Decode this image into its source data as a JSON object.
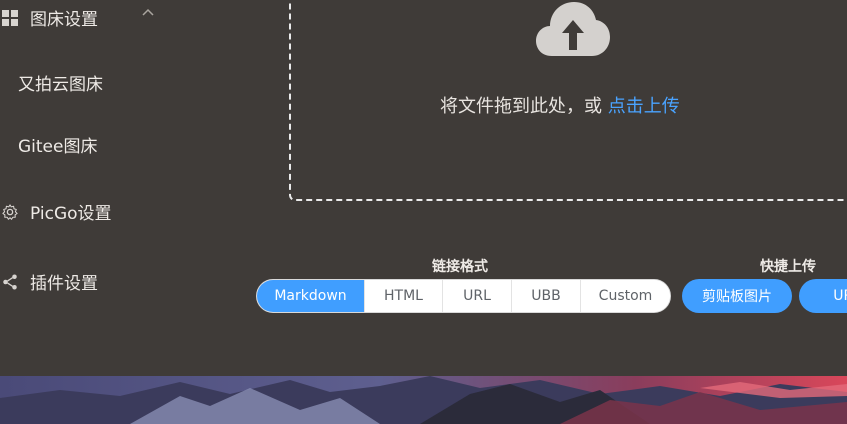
{
  "sidebar": {
    "picbed_settings": "图床设置",
    "items": [
      "又拍云图床",
      "Gitee图床"
    ],
    "picgo_settings": "PicGo设置",
    "plugin_settings": "插件设置"
  },
  "upload": {
    "drop_text": "将文件拖到此处，或 ",
    "click_upload": "点击上传"
  },
  "link_format": {
    "label": "链接格式",
    "options": [
      "Markdown",
      "HTML",
      "URL",
      "UBB",
      "Custom"
    ],
    "selected": "Markdown"
  },
  "quick_upload": {
    "label": "快捷上传",
    "clipboard_button": "剪贴板图片",
    "url_button": "URL"
  },
  "colors": {
    "accent": "#409eff",
    "background": "#3f3b38"
  }
}
